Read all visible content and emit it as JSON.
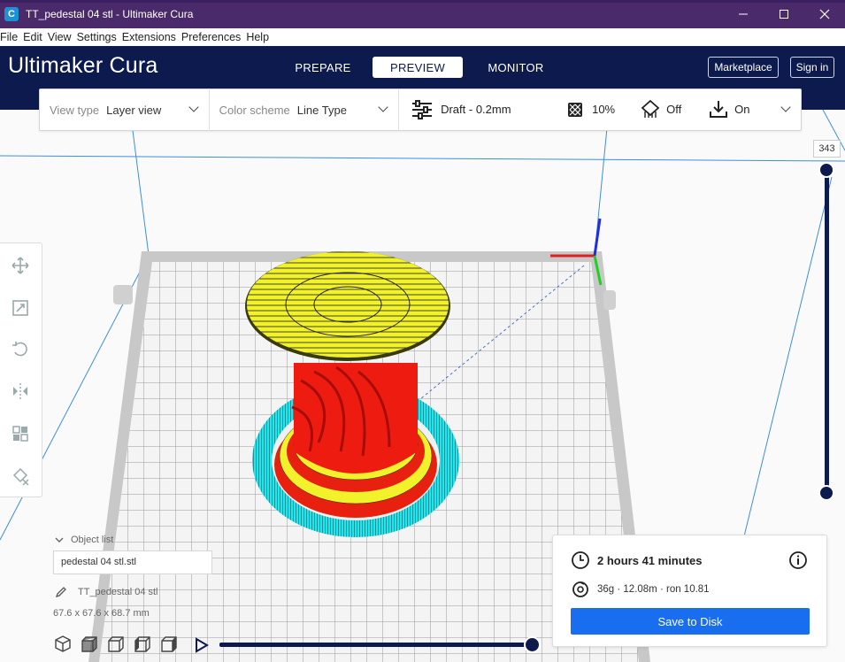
{
  "window": {
    "title": "TT_pedestal 04 stl - Ultimaker Cura",
    "app_icon": "C",
    "controls": [
      "minimize-icon",
      "maximize-icon",
      "close-icon"
    ]
  },
  "menu": {
    "items": [
      "File",
      "Edit",
      "View",
      "Settings",
      "Extensions",
      "Preferences",
      "Help"
    ]
  },
  "header": {
    "brand_bold": "Ultimaker",
    "brand_light": "Cura",
    "tabs": [
      {
        "label": "PREPARE",
        "active": false
      },
      {
        "label": "PREVIEW",
        "active": true
      },
      {
        "label": "MONITOR",
        "active": false
      }
    ],
    "marketplace_label": "Marketplace",
    "signin_label": "Sign in",
    "background_color": "#0d1a4e"
  },
  "settings_bar": {
    "view_type_label": "View type",
    "view_type_value": "Layer view",
    "color_scheme_label": "Color scheme",
    "color_scheme_value": "Line Type",
    "profile_value": "Draft - 0.2mm",
    "infill_value": "10%",
    "support_value": "Off",
    "adhesion_value": "On"
  },
  "layer_slider": {
    "current_layer": "343"
  },
  "object_list": {
    "header": "Object list",
    "field_value": "pedestal 04 stl.stl",
    "object_name": "TT_pedestal 04 stl",
    "dimensions": "67.6 x 67.6 x 68.7 mm"
  },
  "print_info": {
    "time": "2 hours 41 minutes",
    "stats": "36g · 12.08m · ron 10.81",
    "save_label": "Save to Disk",
    "accent_color": "#196ef0"
  },
  "colors": {
    "model_top": "#f2f22a",
    "model_wall": "#ee1c10",
    "model_skirt": "#22e6ee"
  }
}
